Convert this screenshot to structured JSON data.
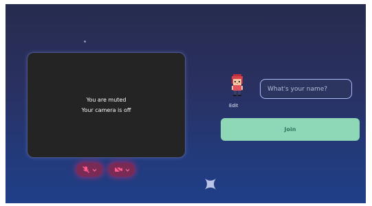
{
  "preview": {
    "muted_text": "You are muted",
    "camera_text": "Your camera is off"
  },
  "controls": {
    "mic_icon": "mic-off-icon",
    "camera_icon": "camera-off-icon",
    "dropdown_icon": "chevron-down-icon"
  },
  "profile": {
    "avatar_icon": "character-avatar",
    "edit_label": "Edit",
    "name_placeholder": "What's your name?",
    "name_value": ""
  },
  "join_label": "Join",
  "colors": {
    "join_button": "#8ed8b7",
    "control_active": "#7a2b55",
    "input_border": "#aebcf8"
  }
}
